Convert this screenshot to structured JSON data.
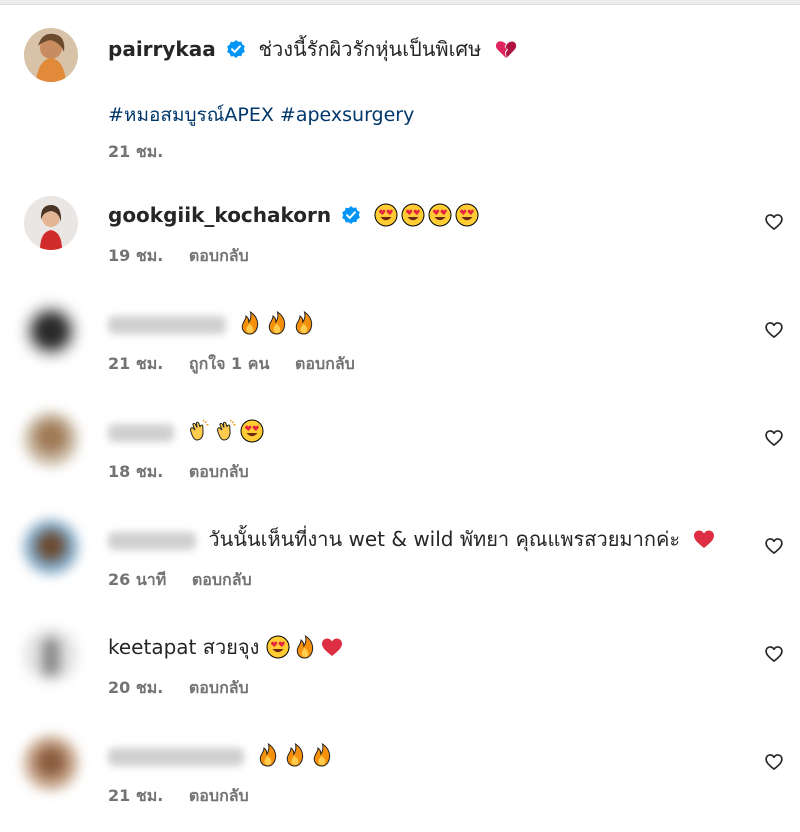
{
  "post_caption": {
    "username": "pairrykaa",
    "text": "ช่วงนี้รักผิวรักหุ่นเป็นพิเศษ",
    "hashtags": "#หมอสมบูรณ์APEX #apexsurgery",
    "time": "21 ชม."
  },
  "reply_label": "ตอบกลับ",
  "comments": [
    {
      "username": "gookgiik_kochakorn",
      "text": "",
      "emoji": [
        "heart-eyes",
        "heart-eyes",
        "heart-eyes",
        "heart-eyes"
      ],
      "time": "19 ชม.",
      "likes": ""
    },
    {
      "username": "",
      "text": "",
      "emoji": [
        "fire",
        "fire",
        "fire"
      ],
      "time": "21 ชม.",
      "likes": "ถูกใจ 1 คน"
    },
    {
      "username": "",
      "text": "",
      "emoji": [
        "clap",
        "clap",
        "heart-eyes"
      ],
      "time": "18 ชม.",
      "likes": ""
    },
    {
      "username": "",
      "text": "วันนั้นเห็นที่งาน wet & wild พัทยา คุณแพรสวยมากค่ะ",
      "emoji": [
        "red-heart"
      ],
      "time": "26 นาที",
      "likes": ""
    },
    {
      "username": "keetapat",
      "text": "สวยจุง",
      "emoji": [
        "heart-eyes",
        "fire",
        "red-heart"
      ],
      "time": "20 ชม.",
      "likes": ""
    },
    {
      "username": "",
      "text": "",
      "emoji": [
        "fire",
        "fire",
        "fire"
      ],
      "time": "21 ชม.",
      "likes": ""
    }
  ],
  "colors": {
    "accent": "#0095f6",
    "hashtag": "#00376b",
    "muted": "#737373"
  }
}
